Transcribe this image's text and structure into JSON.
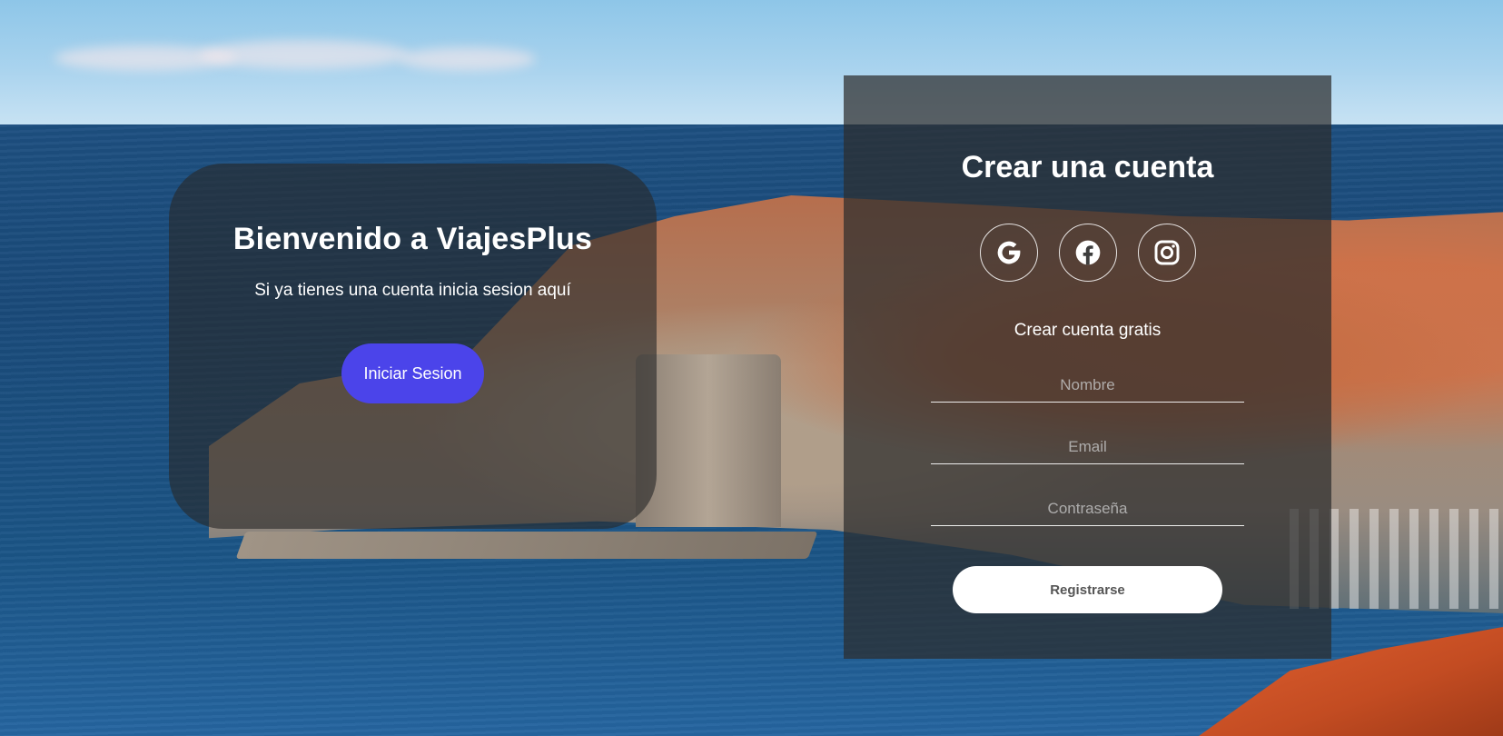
{
  "welcome": {
    "title": "Bienvenido a ViajesPlus",
    "subtitle": "Si ya tienes una cuenta inicia sesion aquí",
    "login_label": "Iniciar Sesion"
  },
  "register": {
    "title": "Crear una cuenta",
    "social": [
      "google-icon",
      "facebook-icon",
      "instagram-icon"
    ],
    "free_label": "Crear cuenta gratis",
    "fields": {
      "name_placeholder": "Nombre",
      "email_placeholder": "Email",
      "password_placeholder": "Contraseña"
    },
    "submit_label": "Registrarse"
  },
  "colors": {
    "accent": "#4b44ea",
    "card_overlay": "rgba(40,40,40,0.62)",
    "panel_overlay": "rgba(45,45,45,0.72)",
    "text": "#ffffff"
  }
}
